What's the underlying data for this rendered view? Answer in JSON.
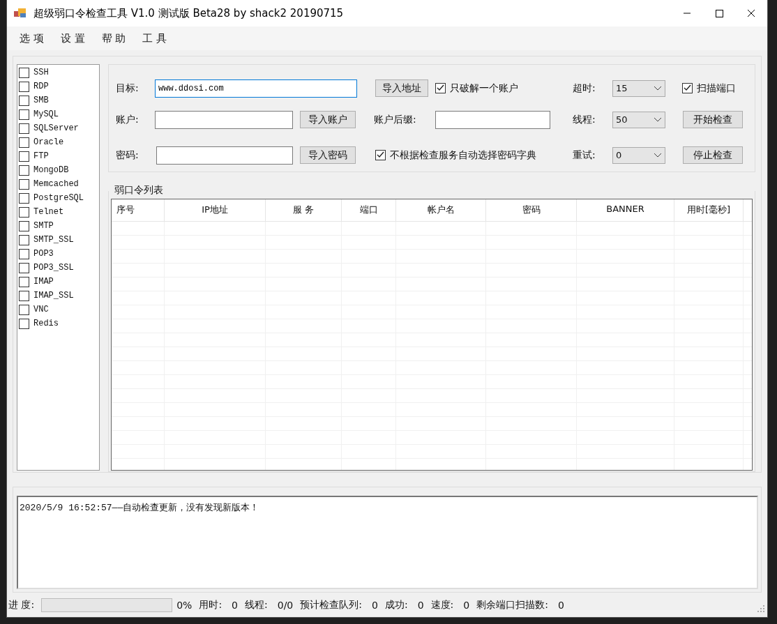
{
  "window": {
    "title": "超级弱口令检查工具 V1.0 测试版 Beta28 by shack2 20190715"
  },
  "menu": [
    "选 项",
    "设 置",
    "帮 助",
    "工 具"
  ],
  "services": [
    {
      "label": "SSH",
      "checked": false
    },
    {
      "label": "RDP",
      "checked": false
    },
    {
      "label": "SMB",
      "checked": false
    },
    {
      "label": "MySQL",
      "checked": false
    },
    {
      "label": "SQLServer",
      "checked": false
    },
    {
      "label": "Oracle",
      "checked": false
    },
    {
      "label": "FTP",
      "checked": false
    },
    {
      "label": "MongoDB",
      "checked": false
    },
    {
      "label": "Memcached",
      "checked": false
    },
    {
      "label": "PostgreSQL",
      "checked": false
    },
    {
      "label": "Telnet",
      "checked": false
    },
    {
      "label": "SMTP",
      "checked": false
    },
    {
      "label": "SMTP_SSL",
      "checked": false
    },
    {
      "label": "POP3",
      "checked": false
    },
    {
      "label": "POP3_SSL",
      "checked": false
    },
    {
      "label": "IMAP",
      "checked": false
    },
    {
      "label": "IMAP_SSL",
      "checked": false
    },
    {
      "label": "VNC",
      "checked": false
    },
    {
      "label": "Redis",
      "checked": false
    }
  ],
  "form": {
    "target": {
      "label": "目标:",
      "value": "www.ddosi.com",
      "focused": true
    },
    "import_address": "导入地址",
    "crack_one": {
      "label": "只破解一个账户",
      "checked": true
    },
    "timeout": {
      "label": "超时:",
      "value": "15"
    },
    "scan_ports": {
      "label": "扫描端口",
      "checked": true
    },
    "account": {
      "label": "账户:"
    },
    "import_account": "导入账户",
    "suffix": {
      "label": "账户后缀:"
    },
    "threads": {
      "label": "线程:",
      "value": "50"
    },
    "start": "开始检查",
    "password": {
      "label": "密码:"
    },
    "import_password": "导入密码",
    "no_auto_dict": {
      "label": "不根据检查服务自动选择密码字典",
      "checked": true
    },
    "retry": {
      "label": "重试:",
      "value": "0"
    },
    "stop": "停止检查"
  },
  "table": {
    "title": "弱口令列表",
    "columns": [
      "序号",
      "IP地址",
      "服 务",
      "端口",
      "帐户名",
      "密码",
      "BANNER",
      "用时[毫秒]"
    ]
  },
  "log": "2020/5/9 16:52:57——自动检查更新，没有发现新版本！",
  "status_bar": {
    "progress_label": "进 度:",
    "progress": {
      "level": 0,
      "reading": "0%"
    },
    "items": [
      {
        "label": "用时:",
        "value": "0"
      },
      {
        "label": "线程:",
        "value": "0/0"
      },
      {
        "label": "预计检查队列:",
        "value": "0"
      },
      {
        "label": "成功:",
        "value": "0"
      },
      {
        "label": "速度:",
        "value": "0"
      },
      {
        "label": "剩余端口扫描数:",
        "value": "0"
      }
    ]
  }
}
